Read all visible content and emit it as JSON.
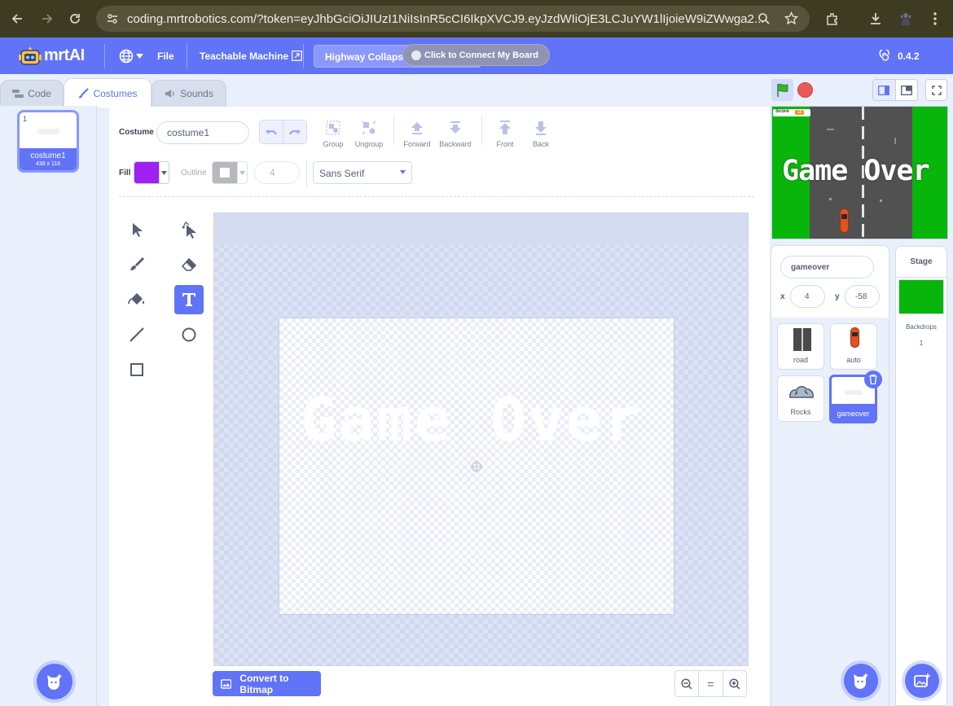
{
  "browser": {
    "url": "coding.mrtrobotics.com/?token=eyJhbGciOiJIUzI1NiIsInR5cCI6IkpXVCJ9.eyJzdWIiOjE3LCJuYW1lIjoieW9iZWwga2..."
  },
  "menubar": {
    "brand": "mrtAI",
    "file_label": "File",
    "teachable_label": "Teachable Machine",
    "project_title": "Highway Collapse",
    "connect_label": "Click to Connect My Board",
    "version": "0.4.2"
  },
  "tabs": [
    {
      "label": "Code"
    },
    {
      "label": "Costumes"
    },
    {
      "label": "Sounds"
    }
  ],
  "costume_list": [
    {
      "index": "1",
      "name": "costume1",
      "size": "438 x 116"
    }
  ],
  "editor": {
    "costume_label": "Costume",
    "costume_name": "costume1",
    "group_label": "Group",
    "ungroup_label": "Ungroup",
    "forward_label": "Forward",
    "backward_label": "Backward",
    "front_label": "Front",
    "back_label": "Back",
    "fill_label": "Fill",
    "fill_color": "#a020f0",
    "outline_label": "Outline",
    "outline_width": "4",
    "font_name": "Sans Serif",
    "canvas_text": "Game Over",
    "convert_label": "Convert to Bitmap",
    "zoom_reset": "="
  },
  "stage": {
    "score_label": "Score",
    "score_value": "11",
    "overlay_text": "Game Over"
  },
  "sprite_info": {
    "name": "gameover",
    "x_label": "x",
    "x_value": "4",
    "y_label": "y",
    "y_value": "-58"
  },
  "sprites": [
    {
      "name": "road"
    },
    {
      "name": "auto"
    },
    {
      "name": "Rocks"
    },
    {
      "name": "gameover"
    }
  ],
  "stage_panel": {
    "title": "Stage",
    "backdrops_label": "Backdrops",
    "backdrops_count": "1"
  },
  "colors": {
    "accent": "#6173f7",
    "stage_green": "#08b50b"
  }
}
